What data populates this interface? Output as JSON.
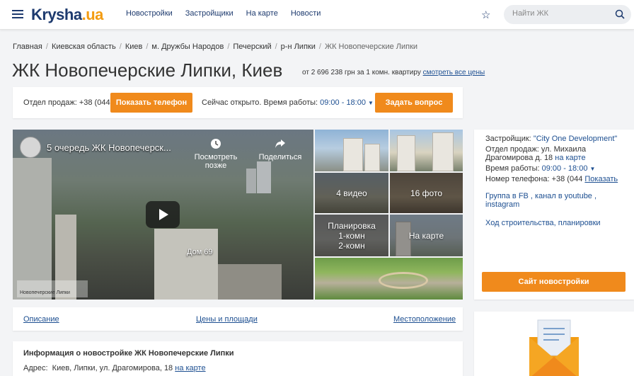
{
  "header": {
    "logo_main": "Krysha",
    "logo_tld": ".ua",
    "nav": [
      "Новостройки",
      "Застройщики",
      "На карте",
      "Новости"
    ],
    "search_placeholder": "Найти ЖК"
  },
  "breadcrumbs": [
    "Главная",
    "Киевская область",
    "Киев",
    "м. Дружбы Народов",
    "Печерский",
    "р-н Липки",
    "ЖК Новопечерские Липки"
  ],
  "title": "ЖК Новопечерские Липки, Киев",
  "price": {
    "text": "от 2 696 238 грн за 1 комн. квартиру",
    "link": "смотреть все цены"
  },
  "sales": {
    "dept": "Отдел продаж: +38 (044",
    "show_phone": "Показать телефон",
    "open_label": "Сейчас открыто. Время работы:",
    "hours": "09:00 - 18:00",
    "ask": "Задать вопрос"
  },
  "video": {
    "title": "5 очередь ЖК Новопечерск...",
    "watch_later": "Посмотреть позже",
    "share": "Поделиться",
    "caption": "Дом 69",
    "watermark": "Новопечерские Липки"
  },
  "tiles": {
    "videos": "4 видео",
    "photos": "16 фото",
    "plan_l1": "Планировка",
    "plan_l2": "1-комн",
    "plan_l3": "2-комн",
    "map": "На карте"
  },
  "info": {
    "developer_label": "Застройщик:",
    "developer": "\"City One Development\"",
    "sales_l1": "Отдел продаж: ул. Михаила",
    "sales_l2": "Драгомирова д. 18",
    "on_map": "на карте",
    "hours_label": "Время работы:",
    "hours": "09:00 - 18:00",
    "phone_label": "Номер телефона: +38 (044",
    "show": "Показать",
    "social_l1": "Группа в FB , канал в youtube ,",
    "social_l2": "instagram",
    "construction": "Ход строительства, планировки",
    "subscribe": "Сайт новостройки"
  },
  "tabs": [
    "Описание",
    "Цены и площади",
    "Местоположение"
  ],
  "description": {
    "heading": "Информация о новостройке ЖК Новопечерские Липки",
    "address_label": "Адрес:",
    "address": "Киев, Липки, ул. Драгомирова, 18",
    "on_map": "на карте"
  },
  "colors": {
    "accent": "#f08a1c",
    "link": "#1d4f91",
    "brand": "#1d3a6e",
    "logo_tld": "#f39c12"
  },
  "icons": [
    "menu-icon",
    "star-icon",
    "search-icon",
    "clock-icon",
    "share-icon",
    "play-icon",
    "envelope-icon"
  ]
}
